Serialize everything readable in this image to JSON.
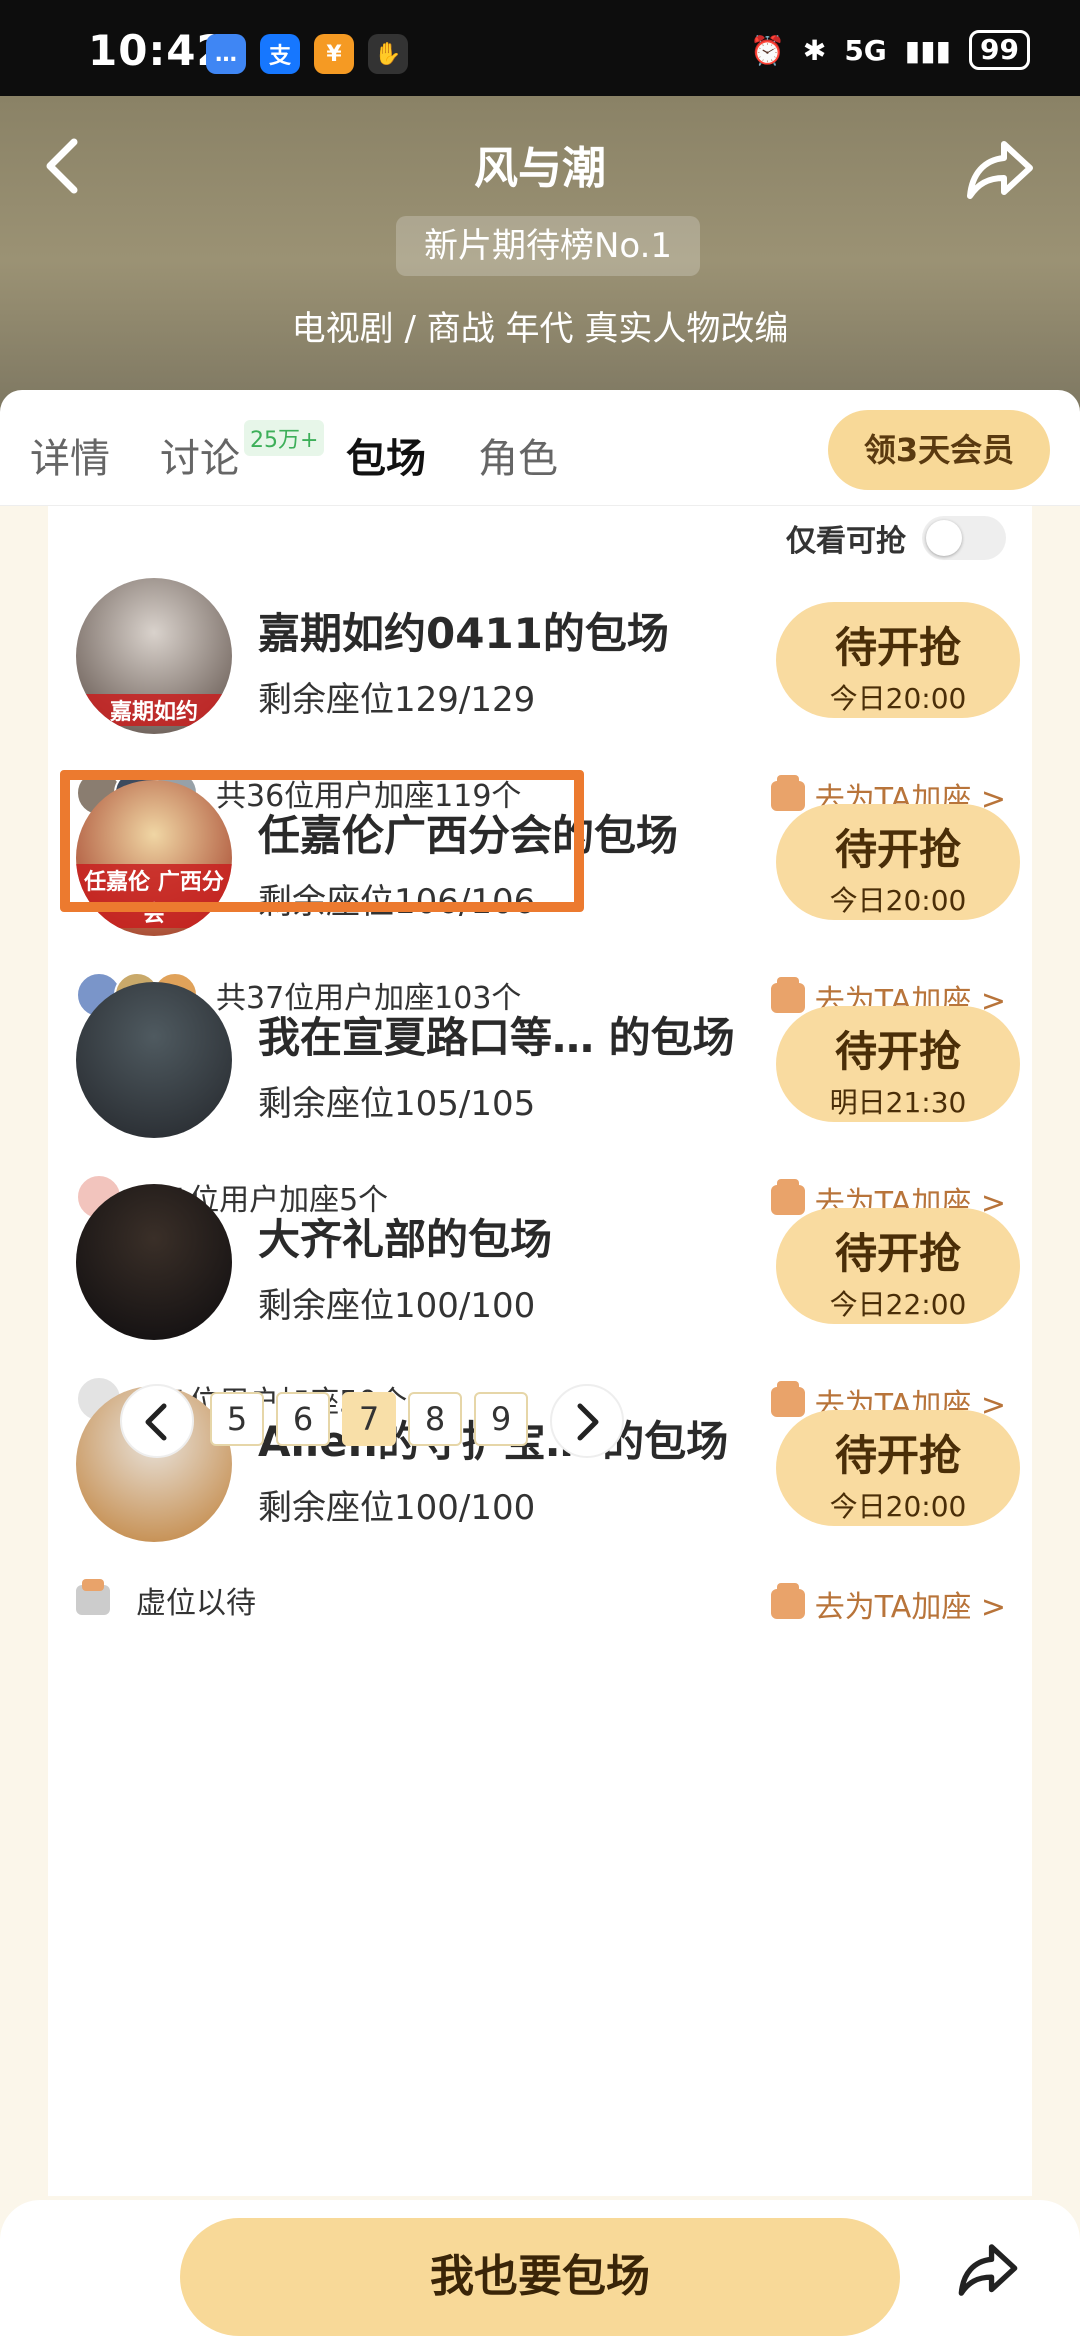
{
  "status_bar": {
    "time": "10:42",
    "network": "5G",
    "battery": "99",
    "apps": [
      {
        "icon": "message-icon",
        "color": "#3f86f4",
        "glyph": "…"
      },
      {
        "icon": "alipay-icon",
        "color": "#1677ff",
        "glyph": "支"
      },
      {
        "icon": "pay-icon",
        "color": "#f59a23",
        "glyph": "¥"
      },
      {
        "icon": "hand-icon",
        "color": "#333333",
        "glyph": "✋"
      }
    ]
  },
  "header": {
    "title": "风与潮",
    "rank_badge": "新片期待榜No.1",
    "genre": "电视剧 / 商战 年代 真实人物改编"
  },
  "tabs": [
    {
      "label": "详情",
      "active": false
    },
    {
      "label": "讨论",
      "active": false,
      "badge": "25万+"
    },
    {
      "label": "包场",
      "active": true
    },
    {
      "label": "角色",
      "active": false
    }
  ],
  "vip_button": "领3天会员",
  "filter": {
    "label": "仅看可抢",
    "on": false
  },
  "screenings": [
    {
      "title": "嘉期如约0411的包场",
      "seats": "剩余座位129/129",
      "button_main": "待开抢",
      "button_time": "今日20:00",
      "users_text": "共36位用户加座119个",
      "add_label": "去为TA加座 >",
      "avatar_caption": "嘉期如约",
      "avatar_colors": [
        "#d9d2cc",
        "#6b5e57"
      ],
      "mini_avatars": [
        "#8a7d70",
        "#3e4b5e",
        "#97a1a8"
      ]
    },
    {
      "title": "任嘉伦广西分会的包场",
      "seats": "剩余座位106/106",
      "button_main": "待开抢",
      "button_time": "今日20:00",
      "users_text": "共37位用户加座103个",
      "add_label": "去为TA加座 >",
      "avatar_caption": "任嘉伦 广西分会",
      "avatar_colors": [
        "#f0d6a4",
        "#a5452e"
      ],
      "mini_avatars": [
        "#7a95c9",
        "#c9a96a",
        "#e0a25a"
      ]
    },
    {
      "title": "我在宣夏路口等… 的包场",
      "seats": "剩余座位105/105",
      "button_main": "待开抢",
      "button_time": "明日21:30",
      "users_text": "共1位用户加座5个",
      "add_label": "去为TA加座 >",
      "avatar_caption": "",
      "avatar_colors": [
        "#4f5a60",
        "#2a2e33"
      ],
      "mini_avatars": [
        "#f2c4bd"
      ]
    },
    {
      "title": "大齐礼部的包场",
      "seats": "剩余座位100/100",
      "button_main": "待开抢",
      "button_time": "今日22:00",
      "users_text": "共1位用户加座50个",
      "add_label": "去为TA加座 >",
      "avatar_caption": "",
      "avatar_colors": [
        "#3a2f28",
        "#141112"
      ],
      "mini_avatars": [
        "#e3e3e3"
      ]
    },
    {
      "title": "Allen的守护宝…  的包场",
      "seats": "剩余座位100/100",
      "button_main": "待开抢",
      "button_time": "今日20:00",
      "users_text": "虚位以待",
      "add_label": "去为TA加座 >",
      "avatar_caption": "",
      "avatar_colors": [
        "#e8e2da",
        "#c58d4e"
      ],
      "mini_avatars": []
    }
  ],
  "pagination": {
    "pages": [
      "5",
      "6",
      "7",
      "8",
      "9"
    ],
    "current": "7",
    "prev": "‹",
    "next": "›"
  },
  "bottom": {
    "book_button": "我也要包场"
  },
  "colors": {
    "accent": "#f8d998",
    "highlight": "#ec7a2f",
    "link": "#b8743a"
  }
}
